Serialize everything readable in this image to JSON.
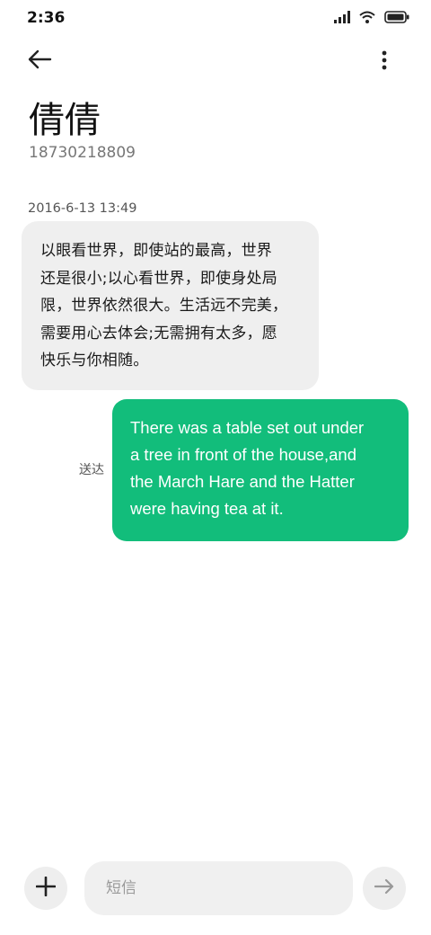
{
  "status_bar": {
    "time": "2:36",
    "icons": [
      "signal-icon",
      "wifi-icon",
      "battery-icon"
    ]
  },
  "header": {
    "back_icon": "arrow-left-icon",
    "more_icon": "more-vertical-icon",
    "contact_name": "倩倩",
    "contact_number": "18730218809"
  },
  "messages": [
    {
      "direction": "incoming",
      "timestamp": "2016-6-13 13:49",
      "lines": [
        "以眼看世界，即使站的最高，世界",
        "还是很小;以心看世界，即使身处局",
        "限，世界依然很大。生活远不完美，",
        "需要用心去体会;无需拥有太多，愿",
        "快乐与你相随。"
      ]
    },
    {
      "direction": "outgoing",
      "status": "送达",
      "lines": [
        "There was a table set out under",
        "a tree in front of the house,and",
        "the March Hare and the Hatter",
        "were having tea at it."
      ]
    }
  ],
  "composer": {
    "add_icon": "plus-icon",
    "placeholder": "短信",
    "send_icon": "arrow-right-icon"
  },
  "colors": {
    "outgoing_bubble": "#12bd7b",
    "incoming_bubble": "#efefef",
    "background": "#ffffff"
  }
}
